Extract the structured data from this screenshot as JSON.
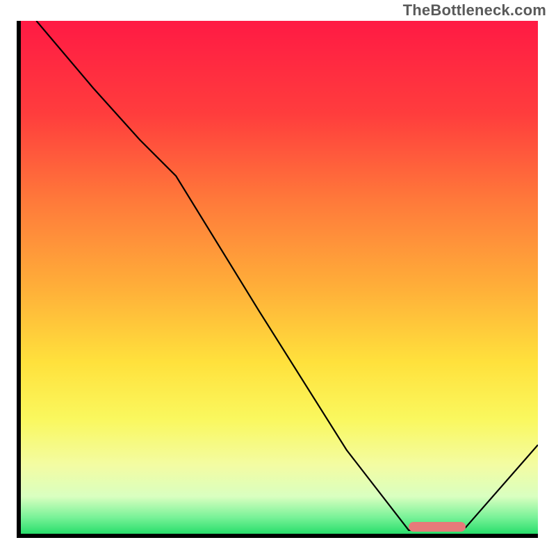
{
  "watermark": "TheBottleneck.com",
  "chart_data": {
    "type": "line",
    "title": "",
    "xlabel": "",
    "ylabel": "",
    "xlim": [
      0,
      100
    ],
    "ylim": [
      0,
      100
    ],
    "grid": false,
    "legend": false,
    "gradient_stops": [
      {
        "pct": 0,
        "color": "#ff1a44"
      },
      {
        "pct": 18,
        "color": "#ff3d3d"
      },
      {
        "pct": 35,
        "color": "#ff7a3a"
      },
      {
        "pct": 52,
        "color": "#ffb039"
      },
      {
        "pct": 66,
        "color": "#ffe13c"
      },
      {
        "pct": 77,
        "color": "#faf85e"
      },
      {
        "pct": 86,
        "color": "#f3fca3"
      },
      {
        "pct": 92,
        "color": "#d9ffc0"
      },
      {
        "pct": 96,
        "color": "#79f298"
      },
      {
        "pct": 100,
        "color": "#14d960"
      }
    ],
    "series": [
      {
        "name": "bottleneck-curve",
        "color": "#000000",
        "x": [
          3,
          14,
          23,
          30,
          46,
          63,
          75,
          80,
          86,
          100
        ],
        "y": [
          100,
          87,
          77,
          70,
          44,
          17,
          1.5,
          1.5,
          2,
          18
        ]
      }
    ],
    "marker": {
      "name": "optimal-range",
      "color": "#e77a7a",
      "x_start": 75,
      "x_end": 86,
      "y": 2.2
    }
  }
}
